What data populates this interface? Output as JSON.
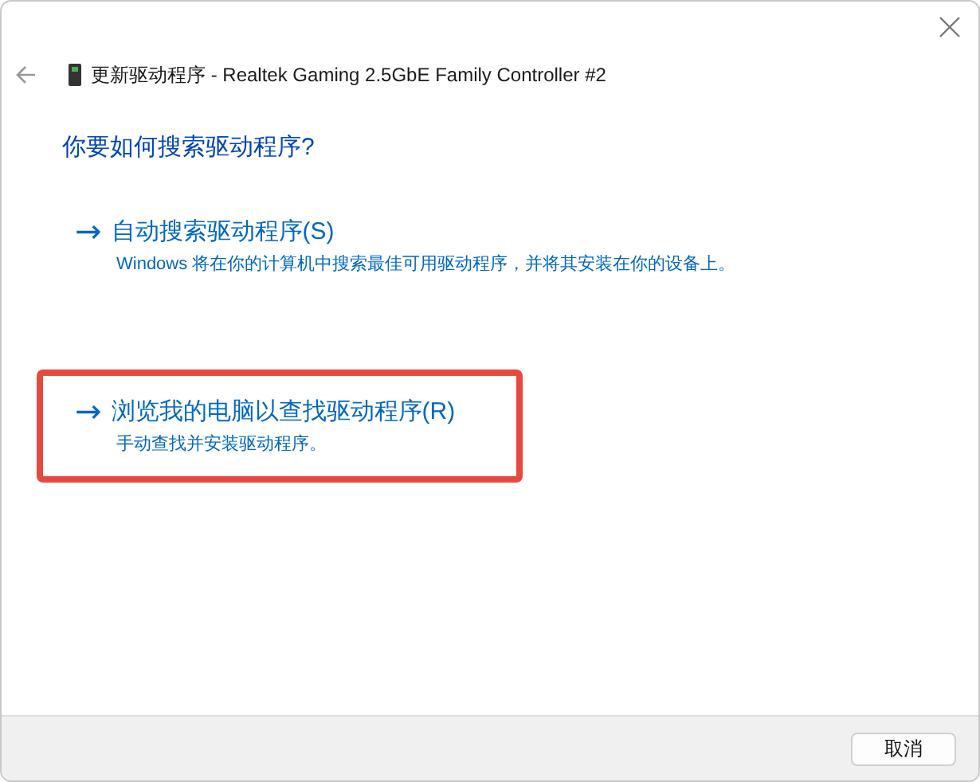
{
  "window": {
    "title": "更新驱动程序 - Realtek Gaming 2.5GbE Family Controller #2"
  },
  "heading": "你要如何搜索驱动程序?",
  "options": [
    {
      "arrow": "→",
      "label": "自动搜索驱动程序(S)",
      "description": "Windows 将在你的计算机中搜索最佳可用驱动程序，并将其安装在你的设备上。",
      "highlighted": false
    },
    {
      "arrow": "→",
      "label": "浏览我的电脑以查找驱动程序(R)",
      "description": "手动查找并安装驱动程序。",
      "highlighted": true
    }
  ],
  "buttons": [
    "取消"
  ]
}
